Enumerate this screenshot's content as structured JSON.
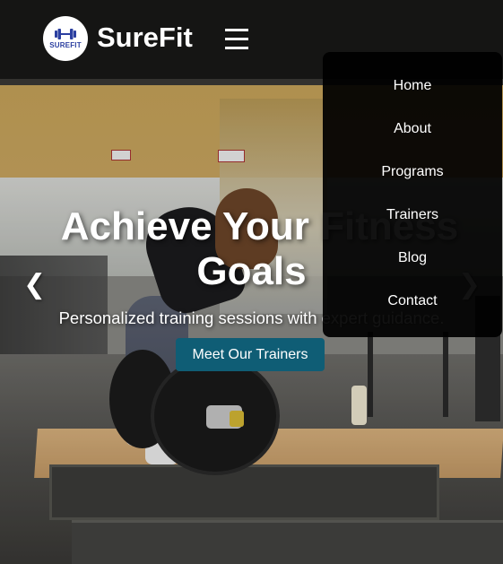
{
  "brand": {
    "logo_text": "SUREFIT",
    "name": "SureFit",
    "logo_color": "#2b3fa0"
  },
  "nav": {
    "menu_icon": "hamburger-menu-icon",
    "items": [
      {
        "label": "Home"
      },
      {
        "label": "About"
      },
      {
        "label": "Programs"
      },
      {
        "label": "Trainers"
      },
      {
        "label": "Blog"
      },
      {
        "label": "Contact"
      }
    ]
  },
  "hero": {
    "title_line1": "Achieve Your Fitness",
    "title_line2": "Goals",
    "subtitle": "Personalized training sessions with expert guidance.",
    "cta_label": "Meet Our Trainers",
    "cta_color": "#0f5d75",
    "prev_icon": "chevron-left-icon",
    "next_icon": "chevron-right-icon",
    "prev_glyph": "❮",
    "next_glyph": "❯"
  }
}
